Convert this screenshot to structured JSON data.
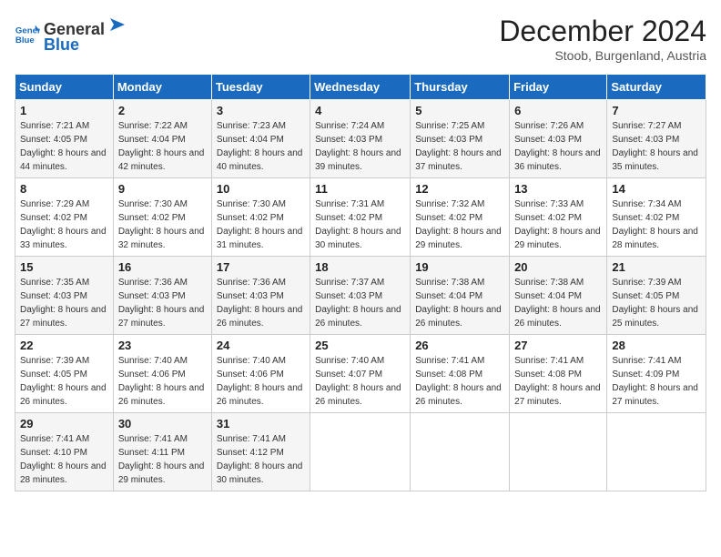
{
  "logo": {
    "line1": "General",
    "line2": "Blue"
  },
  "title": "December 2024",
  "subtitle": "Stoob, Burgenland, Austria",
  "days_of_week": [
    "Sunday",
    "Monday",
    "Tuesday",
    "Wednesday",
    "Thursday",
    "Friday",
    "Saturday"
  ],
  "weeks": [
    [
      {
        "day": "1",
        "rise": "7:21 AM",
        "set": "4:05 PM",
        "daylight": "8 hours and 44 minutes."
      },
      {
        "day": "2",
        "rise": "7:22 AM",
        "set": "4:04 PM",
        "daylight": "8 hours and 42 minutes."
      },
      {
        "day": "3",
        "rise": "7:23 AM",
        "set": "4:04 PM",
        "daylight": "8 hours and 40 minutes."
      },
      {
        "day": "4",
        "rise": "7:24 AM",
        "set": "4:03 PM",
        "daylight": "8 hours and 39 minutes."
      },
      {
        "day": "5",
        "rise": "7:25 AM",
        "set": "4:03 PM",
        "daylight": "8 hours and 37 minutes."
      },
      {
        "day": "6",
        "rise": "7:26 AM",
        "set": "4:03 PM",
        "daylight": "8 hours and 36 minutes."
      },
      {
        "day": "7",
        "rise": "7:27 AM",
        "set": "4:03 PM",
        "daylight": "8 hours and 35 minutes."
      }
    ],
    [
      {
        "day": "8",
        "rise": "7:29 AM",
        "set": "4:02 PM",
        "daylight": "8 hours and 33 minutes."
      },
      {
        "day": "9",
        "rise": "7:30 AM",
        "set": "4:02 PM",
        "daylight": "8 hours and 32 minutes."
      },
      {
        "day": "10",
        "rise": "7:30 AM",
        "set": "4:02 PM",
        "daylight": "8 hours and 31 minutes."
      },
      {
        "day": "11",
        "rise": "7:31 AM",
        "set": "4:02 PM",
        "daylight": "8 hours and 30 minutes."
      },
      {
        "day": "12",
        "rise": "7:32 AM",
        "set": "4:02 PM",
        "daylight": "8 hours and 29 minutes."
      },
      {
        "day": "13",
        "rise": "7:33 AM",
        "set": "4:02 PM",
        "daylight": "8 hours and 29 minutes."
      },
      {
        "day": "14",
        "rise": "7:34 AM",
        "set": "4:02 PM",
        "daylight": "8 hours and 28 minutes."
      }
    ],
    [
      {
        "day": "15",
        "rise": "7:35 AM",
        "set": "4:03 PM",
        "daylight": "8 hours and 27 minutes."
      },
      {
        "day": "16",
        "rise": "7:36 AM",
        "set": "4:03 PM",
        "daylight": "8 hours and 27 minutes."
      },
      {
        "day": "17",
        "rise": "7:36 AM",
        "set": "4:03 PM",
        "daylight": "8 hours and 26 minutes."
      },
      {
        "day": "18",
        "rise": "7:37 AM",
        "set": "4:03 PM",
        "daylight": "8 hours and 26 minutes."
      },
      {
        "day": "19",
        "rise": "7:38 AM",
        "set": "4:04 PM",
        "daylight": "8 hours and 26 minutes."
      },
      {
        "day": "20",
        "rise": "7:38 AM",
        "set": "4:04 PM",
        "daylight": "8 hours and 26 minutes."
      },
      {
        "day": "21",
        "rise": "7:39 AM",
        "set": "4:05 PM",
        "daylight": "8 hours and 25 minutes."
      }
    ],
    [
      {
        "day": "22",
        "rise": "7:39 AM",
        "set": "4:05 PM",
        "daylight": "8 hours and 26 minutes."
      },
      {
        "day": "23",
        "rise": "7:40 AM",
        "set": "4:06 PM",
        "daylight": "8 hours and 26 minutes."
      },
      {
        "day": "24",
        "rise": "7:40 AM",
        "set": "4:06 PM",
        "daylight": "8 hours and 26 minutes."
      },
      {
        "day": "25",
        "rise": "7:40 AM",
        "set": "4:07 PM",
        "daylight": "8 hours and 26 minutes."
      },
      {
        "day": "26",
        "rise": "7:41 AM",
        "set": "4:08 PM",
        "daylight": "8 hours and 26 minutes."
      },
      {
        "day": "27",
        "rise": "7:41 AM",
        "set": "4:08 PM",
        "daylight": "8 hours and 27 minutes."
      },
      {
        "day": "28",
        "rise": "7:41 AM",
        "set": "4:09 PM",
        "daylight": "8 hours and 27 minutes."
      }
    ],
    [
      {
        "day": "29",
        "rise": "7:41 AM",
        "set": "4:10 PM",
        "daylight": "8 hours and 28 minutes."
      },
      {
        "day": "30",
        "rise": "7:41 AM",
        "set": "4:11 PM",
        "daylight": "8 hours and 29 minutes."
      },
      {
        "day": "31",
        "rise": "7:41 AM",
        "set": "4:12 PM",
        "daylight": "8 hours and 30 minutes."
      },
      null,
      null,
      null,
      null
    ]
  ],
  "labels": {
    "sunrise": "Sunrise:",
    "sunset": "Sunset:",
    "daylight": "Daylight:"
  }
}
